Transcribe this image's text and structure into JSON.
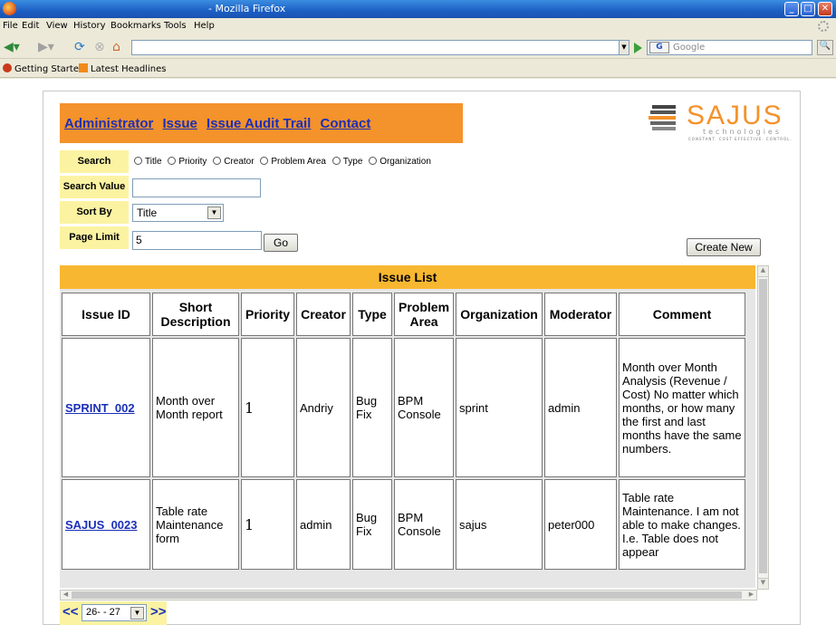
{
  "window": {
    "title": "- Mozilla Firefox",
    "min": "_",
    "max": "□",
    "close": "✕"
  },
  "menu": [
    "File",
    "Edit",
    "View",
    "History",
    "Bookmarks",
    "Tools",
    "Help"
  ],
  "toolbar": {
    "url": "",
    "search_placeholder": "Google",
    "search_engine": "G"
  },
  "bookmarks": [
    "Getting Started",
    "Latest Headlines"
  ],
  "nav_links": [
    "Administrator",
    "Issue",
    "Issue Audit Trail",
    "Contact"
  ],
  "logo": {
    "word": "SAJUS",
    "sub": "technologies",
    "tag": "CONSTANT. COST EFFECTIVE. CONTROL."
  },
  "search": {
    "label": "Search",
    "options": [
      "Title",
      "Priority",
      "Creator",
      "Problem Area",
      "Type",
      "Organization"
    ],
    "value_label": "Search Value",
    "value": "",
    "sort_label": "Sort By",
    "sort_value": "Title",
    "limit_label": "Page Limit",
    "limit_value": "5",
    "go_label": "Go",
    "create_label": "Create New"
  },
  "issue_list": {
    "title": "Issue List",
    "columns": [
      "Issue ID",
      "Short Description",
      "Priority",
      "Creator",
      "Type",
      "Problem Area",
      "Organization",
      "Moderator",
      "Comment"
    ],
    "rows": [
      {
        "id": "SPRINT_002",
        "description": "Month over Month report",
        "priority": "1",
        "creator": "Andriy",
        "type": "Bug Fix",
        "area": "BPM Console",
        "organization": "sprint",
        "moderator": "admin",
        "comment": "Month over Month Analysis (Revenue / Cost) No matter which months, or how many the first and last months have the same numbers."
      },
      {
        "id": "SAJUS_0023",
        "description": "Table rate Maintenance form",
        "priority": "1",
        "creator": "admin",
        "type": "Bug Fix",
        "area": "BPM Console",
        "organization": "sajus",
        "moderator": "peter000",
        "comment": "Table rate Maintenance. I am not able to make changes. I.e. Table does not appear"
      }
    ]
  },
  "pager": {
    "prev": "<<",
    "next": ">>",
    "page_value": "26- - 27"
  }
}
